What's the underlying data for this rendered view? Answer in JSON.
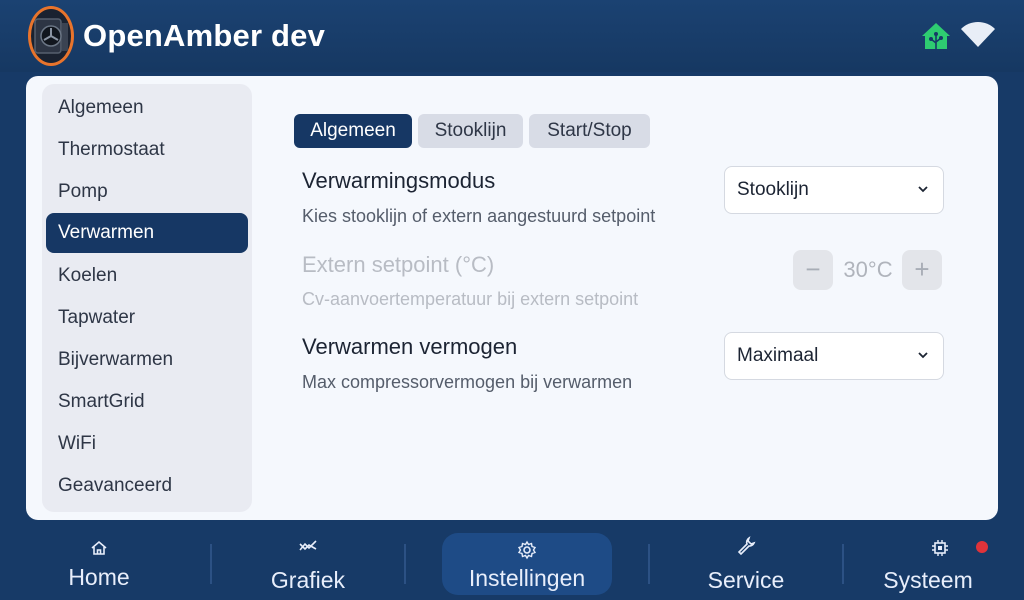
{
  "header": {
    "title": "OpenAmber dev",
    "logo_icon": "heat-pump-logo-icon",
    "status_icons": [
      "home-assistant-icon",
      "wifi-icon"
    ],
    "home_status_color": "#2ecc71"
  },
  "sidebar": {
    "items": [
      {
        "label": "Algemeen",
        "active": false
      },
      {
        "label": "Thermostaat",
        "active": false
      },
      {
        "label": "Pomp",
        "active": false
      },
      {
        "label": "Verwarmen",
        "active": true
      },
      {
        "label": "Koelen",
        "active": false
      },
      {
        "label": "Tapwater",
        "active": false
      },
      {
        "label": "Bijverwarmen",
        "active": false
      },
      {
        "label": "SmartGrid",
        "active": false
      },
      {
        "label": "WiFi",
        "active": false
      },
      {
        "label": "Geavanceerd",
        "active": false
      }
    ]
  },
  "tabs": [
    {
      "label": "Algemeen",
      "active": true
    },
    {
      "label": "Stooklijn",
      "active": false
    },
    {
      "label": "Start/Stop",
      "active": false
    }
  ],
  "settings": {
    "heating_mode": {
      "title": "Verwarmingsmodus",
      "description": "Kies stooklijn of extern aangestuurd setpoint",
      "value": "Stooklijn"
    },
    "external_setpoint": {
      "title": "Extern setpoint (°C)",
      "description": "Cv-aanvoertemperatuur bij extern setpoint",
      "value": "30°C",
      "decrement": "−",
      "increment": "+",
      "enabled": false
    },
    "heating_power": {
      "title": "Verwarmen vermogen",
      "description": "Max compressorvermogen bij verwarmen",
      "value": "Maximaal"
    }
  },
  "bottom_nav": {
    "items": [
      {
        "label": "Home",
        "icon": "home-icon",
        "active": false
      },
      {
        "label": "Grafiek",
        "icon": "chart-icon",
        "active": false
      },
      {
        "label": "Instellingen",
        "icon": "gear-icon",
        "active": true
      },
      {
        "label": "Service",
        "icon": "wrench-icon",
        "active": false
      },
      {
        "label": "Systeem",
        "icon": "chip-icon",
        "active": false
      }
    ],
    "alert_color": "#e0333a"
  },
  "colors": {
    "primary": "#163764",
    "background": "#173a67",
    "card": "#f5f8fd"
  }
}
